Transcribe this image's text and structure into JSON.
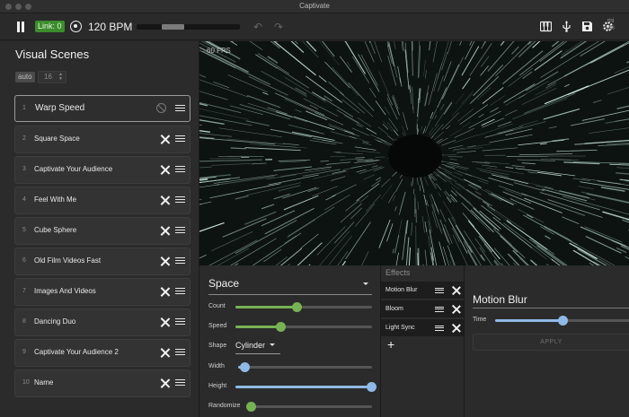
{
  "window": {
    "title": "Captivate"
  },
  "toolbar": {
    "link_label": "Link: 0",
    "bpm_label": "120 BPM",
    "beat_progress": 0.5,
    "midi_note": "mi\ndri"
  },
  "sidebar": {
    "title": "Visual Scenes",
    "auto_label": "auto",
    "auto_value": "16",
    "scenes": [
      {
        "index": "1",
        "name": "Warp Speed"
      },
      {
        "index": "2",
        "name": "Square Space"
      },
      {
        "index": "3",
        "name": "Captivate Your Audience"
      },
      {
        "index": "4",
        "name": "Feel With Me"
      },
      {
        "index": "5",
        "name": "Cube Sphere"
      },
      {
        "index": "6",
        "name": "Old Film Videos Fast"
      },
      {
        "index": "7",
        "name": "Images And Videos"
      },
      {
        "index": "8",
        "name": "Dancing Duo"
      },
      {
        "index": "9",
        "name": "Captivate Your Audience 2"
      },
      {
        "index": "10",
        "name": "Name"
      }
    ]
  },
  "visualizer": {
    "fps_label": "60 FPS"
  },
  "space_panel": {
    "title": "Space",
    "count_label": "Count",
    "count_value": 0.45,
    "speed_label": "Speed",
    "speed_value": 0.33,
    "shape_label": "Shape",
    "shape_value": "Cylinder",
    "width_label": "Width",
    "width_value": 0.05,
    "height_label": "Height",
    "height_value": 1.0,
    "randomize_label": "Randomize",
    "randomize_value": 0.0
  },
  "effects_panel": {
    "title": "Effects",
    "items": [
      {
        "label": "Motion Blur"
      },
      {
        "label": "Bloom"
      },
      {
        "label": "Light Sync"
      }
    ],
    "add_label": "+"
  },
  "motion_blur_panel": {
    "title": "Motion Blur",
    "time_label": "Time",
    "time_value": 0.5,
    "apply_label": "APPLY"
  },
  "colors": {
    "link_green": "#3b8d2c",
    "slider_green": "#77b255",
    "slider_blue": "#8fb9e6"
  }
}
